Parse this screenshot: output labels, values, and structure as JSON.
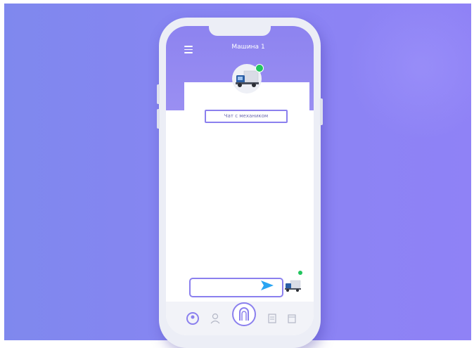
{
  "header": {
    "title": "Машина 1"
  },
  "chat": {
    "label": "Чат с механиком",
    "input_placeholder": ""
  },
  "status": {
    "online_color": "#22c55e"
  },
  "colors": {
    "accent": "#8b80ee",
    "background": "#8a84f3"
  },
  "tabs": [
    {
      "icon": "profile-circle-icon"
    },
    {
      "icon": "user-icon"
    },
    {
      "icon": "home-icon"
    },
    {
      "icon": "document-icon"
    },
    {
      "icon": "calendar-icon"
    }
  ]
}
